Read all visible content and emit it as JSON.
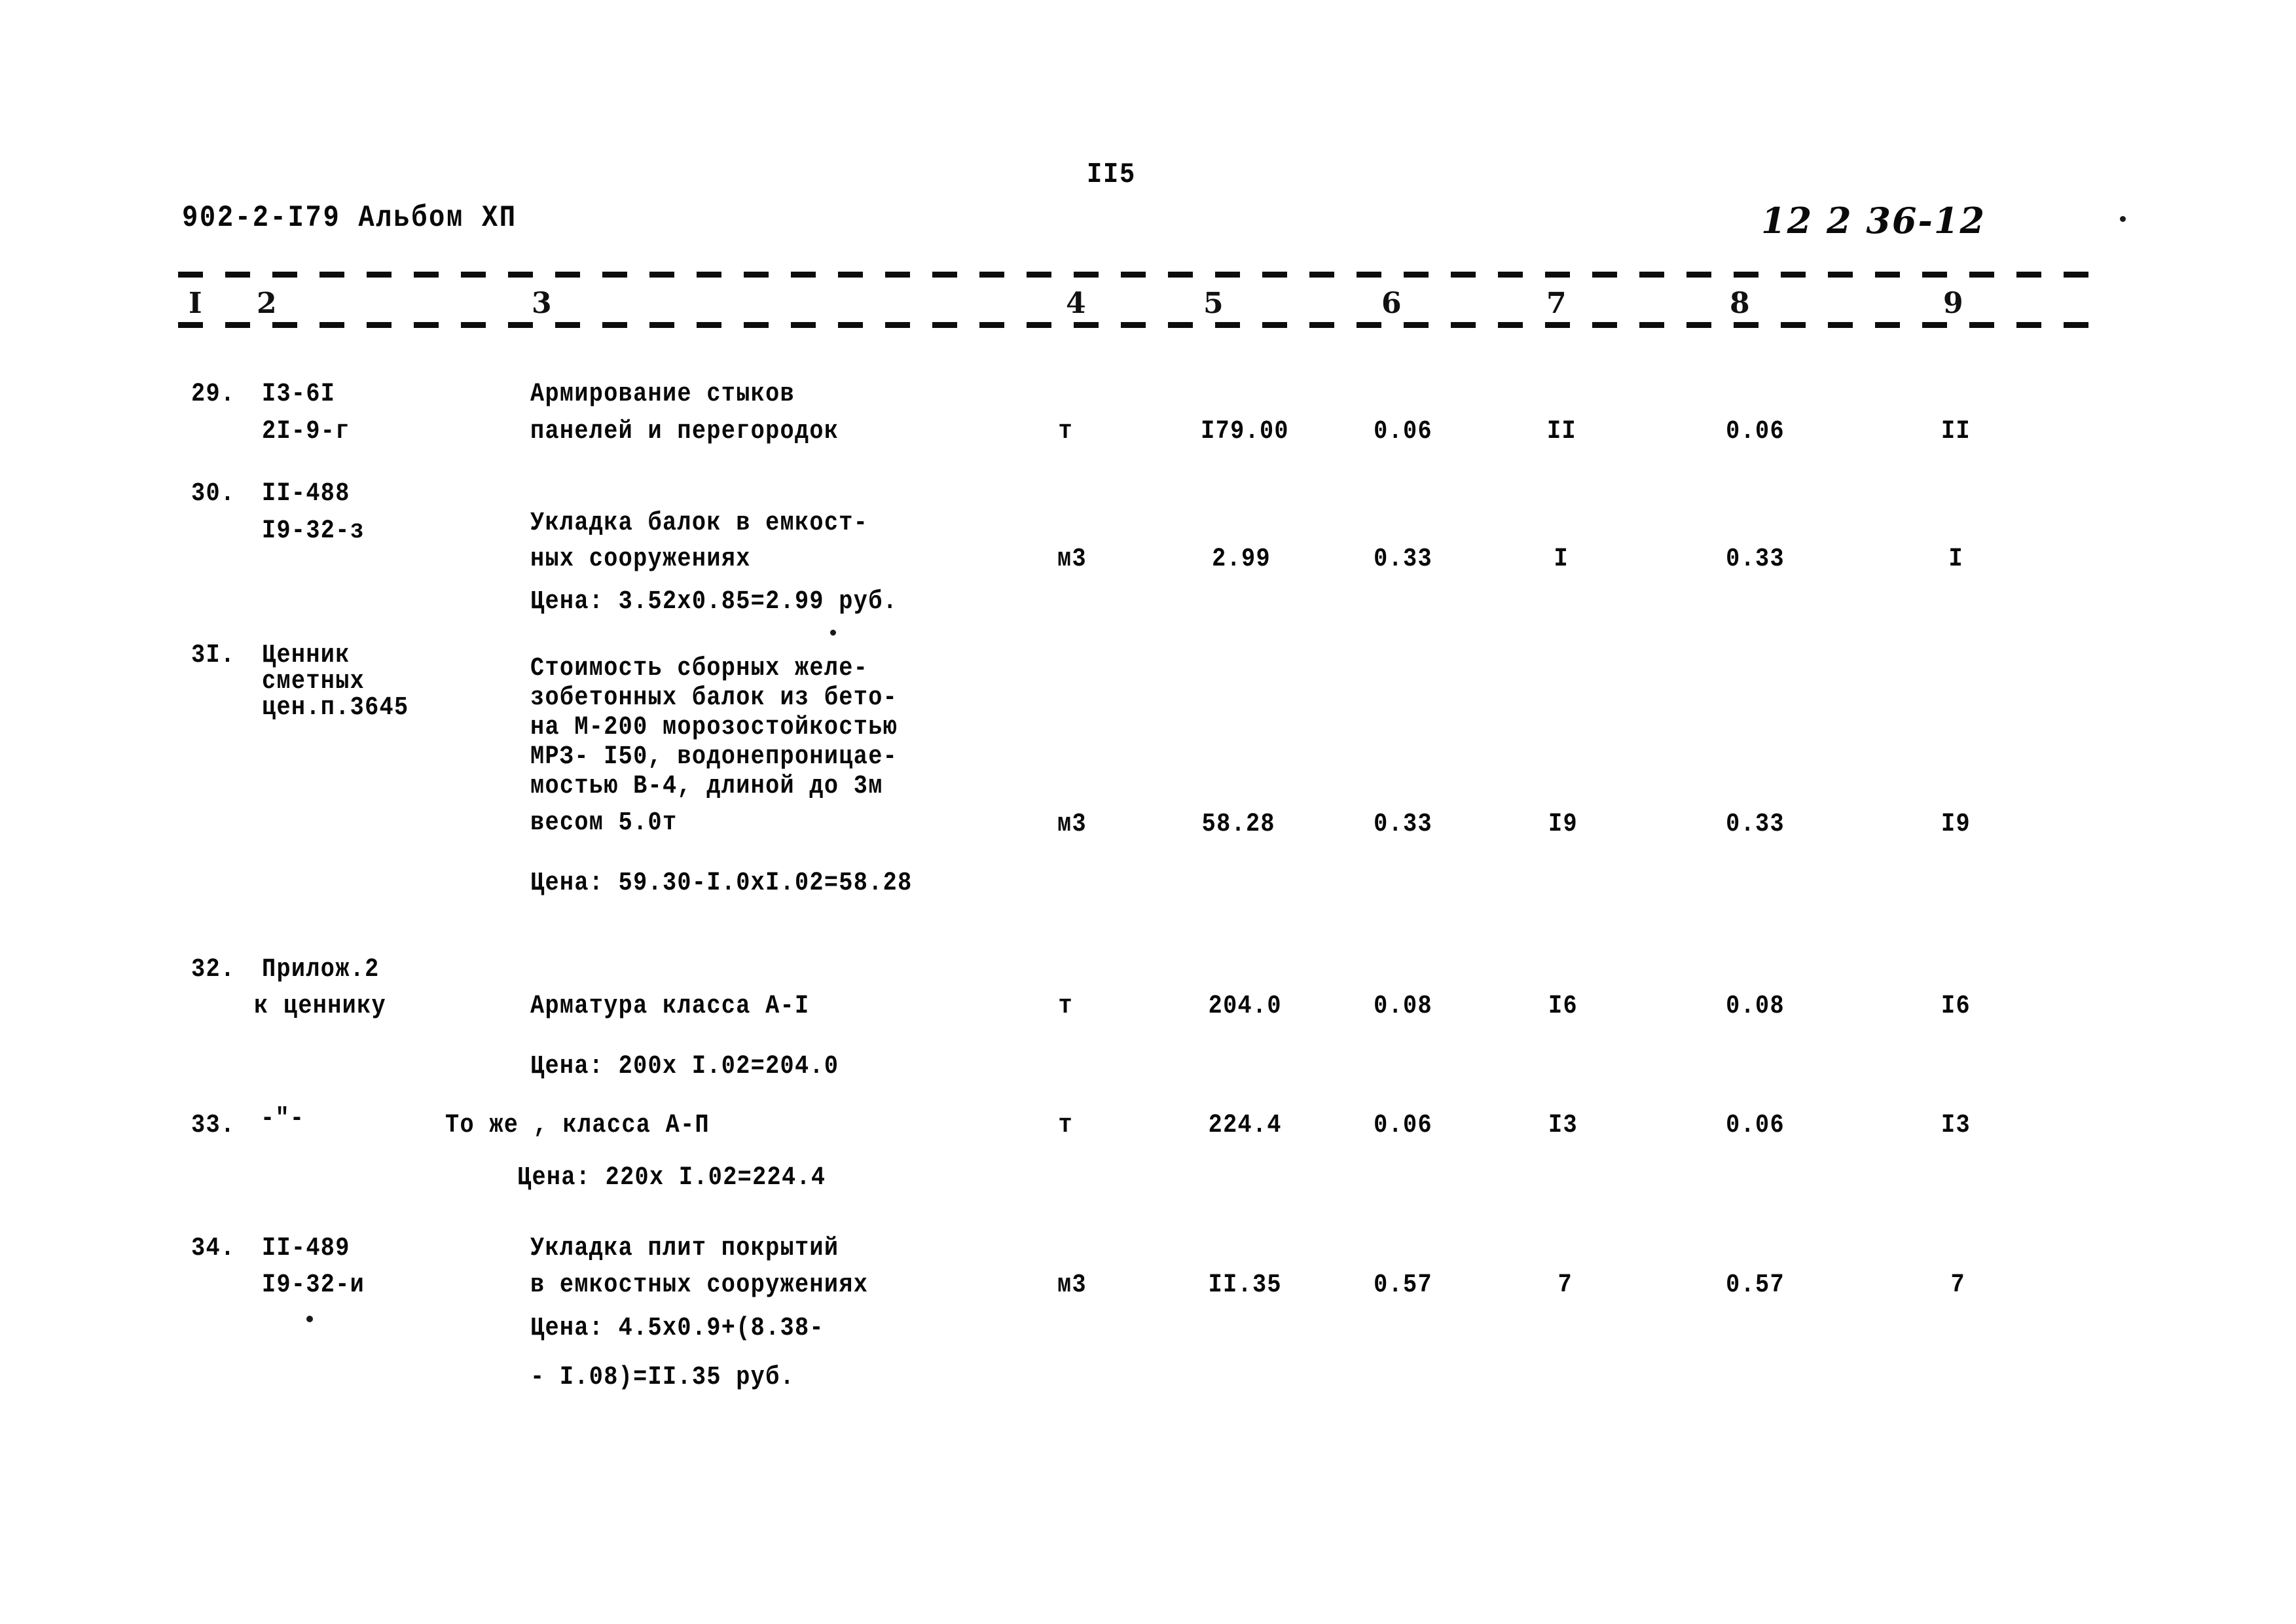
{
  "document": {
    "page_number": "II5",
    "header_left": "902-2-I79 Альбом ХП",
    "header_right_handwritten": "12 2 36-12"
  },
  "table": {
    "column_numbers": [
      "I",
      "2",
      "3",
      "4",
      "5",
      "6",
      "7",
      "8",
      "9"
    ],
    "rows": [
      {
        "no": "29.",
        "code_lines": [
          "I3-6I",
          "2I-9-г"
        ],
        "desc_lines": [
          "Армирование стыков",
          "панелей и перегородок"
        ],
        "unit": "т",
        "col5": "I79.00",
        "col6": "0.06",
        "col7": "II",
        "col8": "0.06",
        "col9": "II",
        "price_note": ""
      },
      {
        "no": "30.",
        "code_lines": [
          "II-488",
          "I9-32-з"
        ],
        "desc_lines": [
          "Укладка балок в емкост-",
          "ных сооружениях"
        ],
        "unit": "м3",
        "col5": "2.99",
        "col6": "0.33",
        "col7": "I",
        "col8": "0.33",
        "col9": "I",
        "price_note": "Цена: 3.52х0.85=2.99 руб."
      },
      {
        "no": "3I.",
        "code_lines": [
          "Ценник",
          "сметных",
          "цен.п.3645"
        ],
        "desc_lines": [
          "Стоимость сборных желе-",
          "зобетонных балок из бето-",
          "на М-200 морозостойкостью",
          "МРЗ- I50, водонепроницае-",
          "мостью В-4, длиной до 3м",
          "весом 5.0т"
        ],
        "unit": "м3",
        "col5": "58.28",
        "col6": "0.33",
        "col7": "I9",
        "col8": "0.33",
        "col9": "I9",
        "price_note": "Цена: 59.30-I.0xI.02=58.28"
      },
      {
        "no": "32.",
        "code_lines": [
          "Прилож.2",
          "к ценнику"
        ],
        "desc_lines": [
          "Арматура класса А-I"
        ],
        "unit": "т",
        "col5": "204.0",
        "col6": "0.08",
        "col7": "I6",
        "col8": "0.08",
        "col9": "I6",
        "price_note": "Цена: 200х I.02=204.0"
      },
      {
        "no": "33.",
        "code_lines": [
          "-\"-"
        ],
        "desc_lines": [
          "То же , класса А-П"
        ],
        "unit": "т",
        "col5": "224.4",
        "col6": "0.06",
        "col7": "I3",
        "col8": "0.06",
        "col9": "I3",
        "price_note": "Цена: 220х I.02=224.4"
      },
      {
        "no": "34.",
        "code_lines": [
          "II-489",
          "I9-32-и"
        ],
        "desc_lines": [
          "Укладка плит покрытий",
          "в емкостных сооружениях"
        ],
        "unit": "м3",
        "col5": "II.35",
        "col6": "0.57",
        "col7": "7",
        "col8": "0.57",
        "col9": "7",
        "price_note": "Цена: 4.5х0.9+(8.38-",
        "price_note_2": "- I.08)=II.35 руб."
      }
    ]
  }
}
